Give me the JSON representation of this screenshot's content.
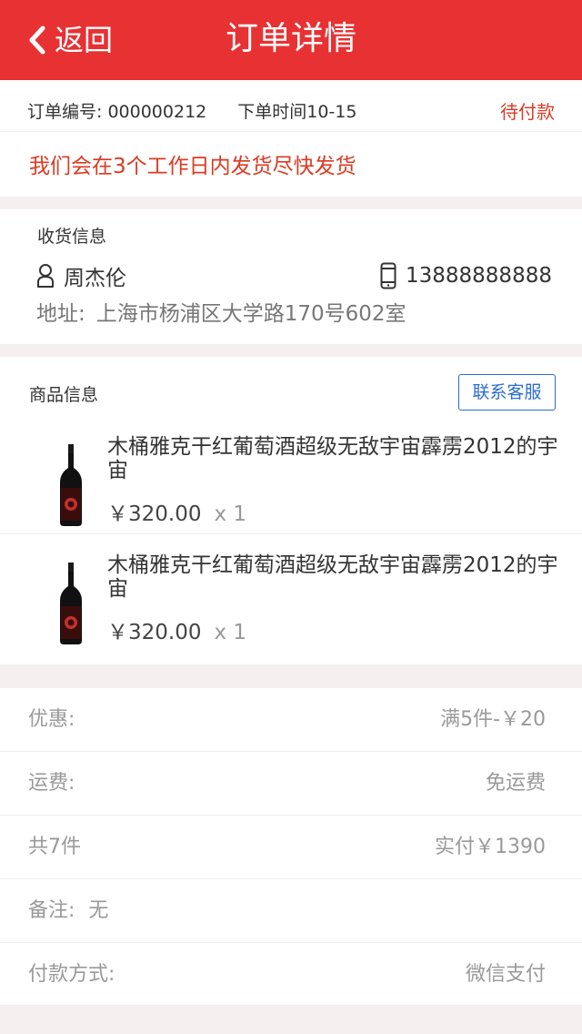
{
  "header": {
    "back_label": "返回",
    "title": "订单详情"
  },
  "order": {
    "number_label": "订单编号:",
    "number": "000000212",
    "time_label": "下单时间",
    "time": "10-15",
    "status": "待付款",
    "notice": "我们会在3个工作日内发货尽快发货"
  },
  "shipping": {
    "title": "收货信息",
    "name": "周杰伦",
    "phone": "13888888888",
    "address_label": "地址:",
    "address": "上海市杨浦区大学路170号602室"
  },
  "goods": {
    "title": "商品信息",
    "service_button": "联系客服",
    "items": [
      {
        "name": "木桶雅克干红葡萄酒超级无敌宇宙霹雳2012的宇宙",
        "price": "￥320.00",
        "qty": "x 1"
      },
      {
        "name": "木桶雅克干红葡萄酒超级无敌宇宙霹雳2012的宇宙",
        "price": "￥320.00",
        "qty": "x 1"
      }
    ]
  },
  "summary": {
    "discount_label": "优惠:",
    "discount_value": "满5件-￥20",
    "shipping_label": "运费:",
    "shipping_value": "免运费",
    "count_label": "共7件",
    "paid_value": "实付￥1390",
    "remark_label": "备注:",
    "remark_value": "无",
    "payment_label": "付款方式:",
    "payment_value": "微信支付"
  },
  "colors": {
    "brand_red": "#e83133",
    "status_red": "#dc3a22",
    "link_blue": "#2a6dd1"
  },
  "icons": {
    "back": "chevron-left-icon",
    "person": "person-icon",
    "phone": "phone-icon",
    "product": "wine-bottle-icon"
  }
}
